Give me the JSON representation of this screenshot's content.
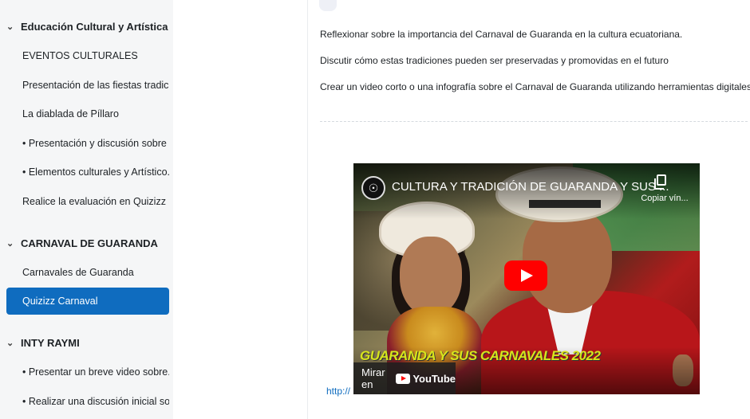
{
  "sidebar": {
    "sections": [
      {
        "title": "Educación Cultural y Artística",
        "items": [
          "EVENTOS CULTURALES",
          "Presentación de las fiestas tradic...",
          "La diablada de Píllaro",
          "• Presentación y discusión sobre ...",
          "• Elementos culturales y Artístico...",
          "Realice la evaluación en Quizizz ..."
        ]
      },
      {
        "title": "CARNAVAL DE GUARANDA",
        "items": [
          "Carnavales de Guaranda",
          "Quizizz Carnaval"
        ]
      },
      {
        "title": "INTY RAYMI",
        "items": [
          "• Presentar un breve video sobre...",
          "• Realizar una discusión inicial so..."
        ]
      }
    ],
    "chevron_icon": "chevron-down-icon",
    "active_item": "Quizizz Carnaval",
    "accent_color": "#0f6cbf"
  },
  "content": {
    "paragraphs": [
      "Reflexionar sobre la importancia del Carnaval de Guaranda en la cultura ecuatoriana.",
      "Discutir cómo estas tradiciones pueden ser preservadas y promovidas en el futuro",
      "Crear un video corto o una infografía sobre el Carnaval de Guaranda utilizando herramientas digitales."
    ],
    "link_text": "http://"
  },
  "video": {
    "title": "CULTURA Y TRADICIÓN DE GUARANDA Y SUS ...",
    "copy_label": "Copiar vín...",
    "overlay_text": "GUARANDA Y SUS CARNAVALES 2022",
    "watch_on_label": "Mirar en",
    "youtube_label": "YouTube",
    "play_color": "#ff0000"
  }
}
